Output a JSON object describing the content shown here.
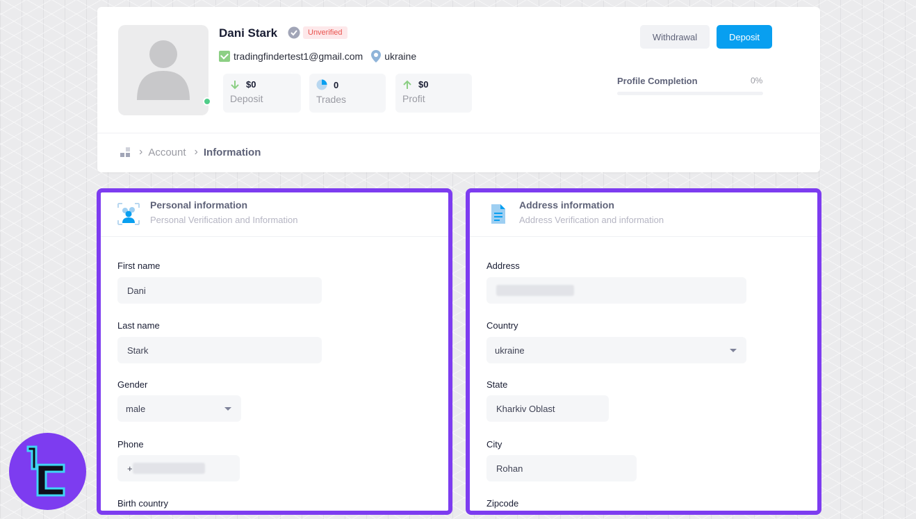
{
  "profile": {
    "name": "Dani Stark",
    "status_badge": "Unverified",
    "email": "tradingfindertest1@gmail.com",
    "location": "ukraine",
    "stats": [
      {
        "value": "$0",
        "label": "Deposit",
        "icon": "arrow-down-icon"
      },
      {
        "value": "0",
        "label": "Trades",
        "icon": "pie-chart-icon"
      },
      {
        "value": "$0",
        "label": "Profit",
        "icon": "arrow-up-icon"
      }
    ],
    "buttons": {
      "withdrawal": "Withdrawal",
      "deposit": "Deposit"
    },
    "completion": {
      "label": "Profile Completion",
      "value": "0%",
      "fraction": 0
    }
  },
  "breadcrumb": {
    "items": [
      "Account",
      "Information"
    ]
  },
  "personal": {
    "title": "Personal information",
    "subtitle": "Personal Verification and Information",
    "fields": {
      "first_name": {
        "label": "First name",
        "value": "Dani"
      },
      "last_name": {
        "label": "Last name",
        "value": "Stark"
      },
      "gender": {
        "label": "Gender",
        "value": "male"
      },
      "phone": {
        "label": "Phone",
        "value": "+"
      },
      "birth_country": {
        "label": "Birth country"
      }
    }
  },
  "address": {
    "title": "Address information",
    "subtitle": "Address Verification and information",
    "fields": {
      "address": {
        "label": "Address"
      },
      "country": {
        "label": "Country",
        "value": "ukraine"
      },
      "state": {
        "label": "State",
        "value": "Kharkiv Oblast"
      },
      "city": {
        "label": "City",
        "value": "Rohan"
      },
      "zipcode": {
        "label": "Zipcode"
      }
    }
  },
  "colors": {
    "accent": "#089ff0",
    "highlight": "#7d3cf0",
    "online": "#50cd89",
    "badge_text": "#e9524d"
  }
}
